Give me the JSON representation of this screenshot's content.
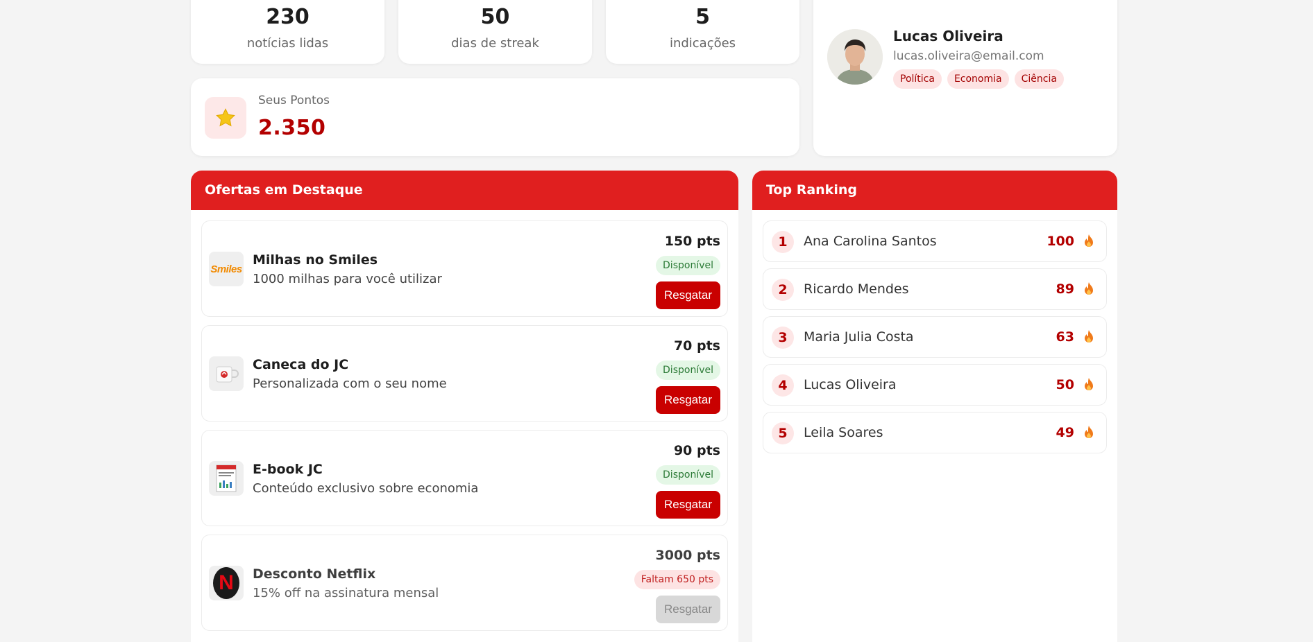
{
  "stats": [
    {
      "value": "230",
      "label": "notícias lidas"
    },
    {
      "value": "50",
      "label": "dias de streak"
    },
    {
      "value": "5",
      "label": "indicações"
    }
  ],
  "points": {
    "label": "Seus Pontos",
    "value": "2.350",
    "icon": "star-icon"
  },
  "profile": {
    "name": "Lucas Oliveira",
    "email": "lucas.oliveira@email.com",
    "tags": [
      "Política",
      "Economia",
      "Ciência"
    ]
  },
  "offers": {
    "title": "Ofertas em Destaque",
    "items": [
      {
        "title": "Milhas no Smiles",
        "desc": "1000 milhas para você utilizar",
        "pts": "150 pts",
        "status": "Disponível",
        "button": "Resgatar",
        "logo_text": "Smiles"
      },
      {
        "title": "Caneca do JC",
        "desc": "Personalizada com o seu nome",
        "pts": "70 pts",
        "status": "Disponível",
        "button": "Resgatar"
      },
      {
        "title": "E-book JC",
        "desc": "Conteúdo exclusivo sobre economia",
        "pts": "90 pts",
        "status": "Disponível",
        "button": "Resgatar"
      },
      {
        "title": "Desconto Netflix",
        "desc": "15% off na assinatura mensal",
        "pts": "3000 pts",
        "status": "Faltam 650 pts",
        "button": "Resgatar",
        "logo_text": "N"
      }
    ]
  },
  "ranking": {
    "title": "Top Ranking",
    "items": [
      {
        "pos": "1",
        "name": "Ana Carolina Santos",
        "pts": "100"
      },
      {
        "pos": "2",
        "name": "Ricardo Mendes",
        "pts": "89"
      },
      {
        "pos": "3",
        "name": "Maria Julia Costa",
        "pts": "63"
      },
      {
        "pos": "4",
        "name": "Lucas Oliveira",
        "pts": "50"
      },
      {
        "pos": "5",
        "name": "Leila Soares",
        "pts": "49"
      }
    ]
  },
  "colors": {
    "accent": "#e01f1f",
    "points": "#b30000",
    "available_bg": "#e4f7e6",
    "missing_bg": "#fde3e3"
  }
}
